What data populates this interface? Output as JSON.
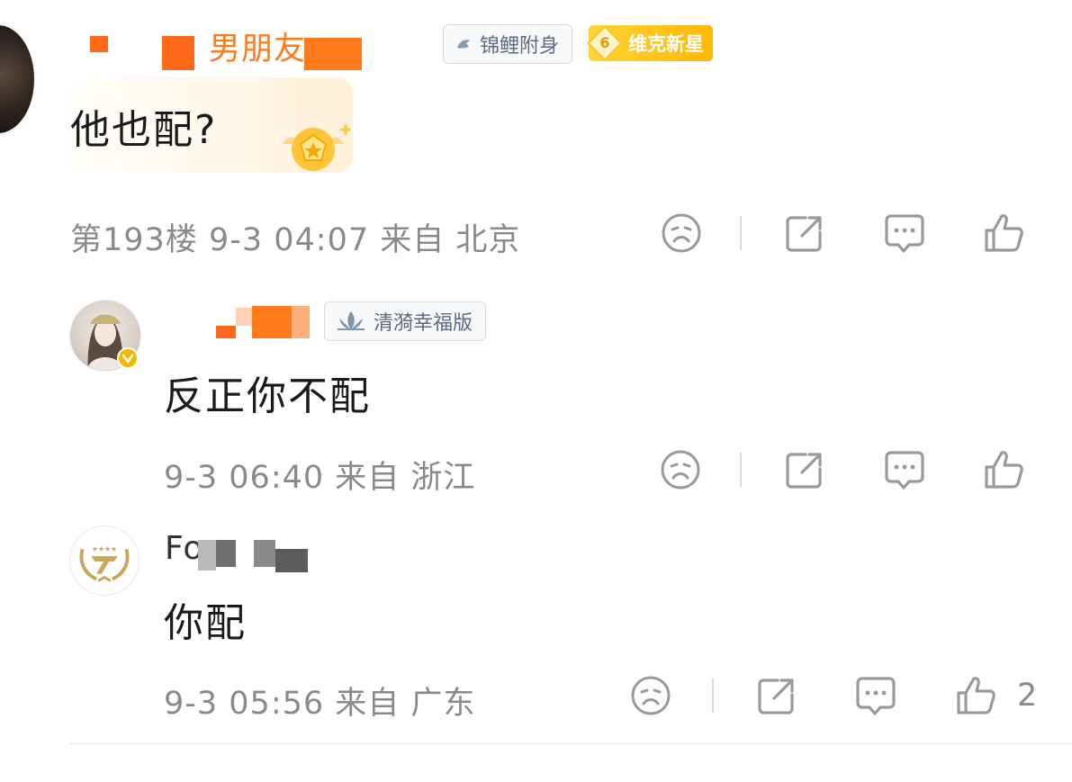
{
  "comments": [
    {
      "username_visible": "男朋友",
      "badges": {
        "first": "锦鲤附身",
        "level": "6",
        "second": "维克新星"
      },
      "text": "他也配?",
      "meta": {
        "floor": "第193楼",
        "time": "9-3 04:07",
        "from": "来自 北京"
      }
    },
    {
      "badge": "清漪幸福版",
      "text": "反正你不配",
      "meta": {
        "time": "9-3 06:40",
        "from": "来自 浙江"
      }
    },
    {
      "username_visible": "Fo",
      "text": "你配",
      "meta": {
        "time": "9-3 05:56",
        "from": "来自 广东"
      },
      "like_count": "2"
    }
  ],
  "icons": [
    "dislike-icon",
    "share-icon",
    "reply-icon",
    "like-icon"
  ]
}
